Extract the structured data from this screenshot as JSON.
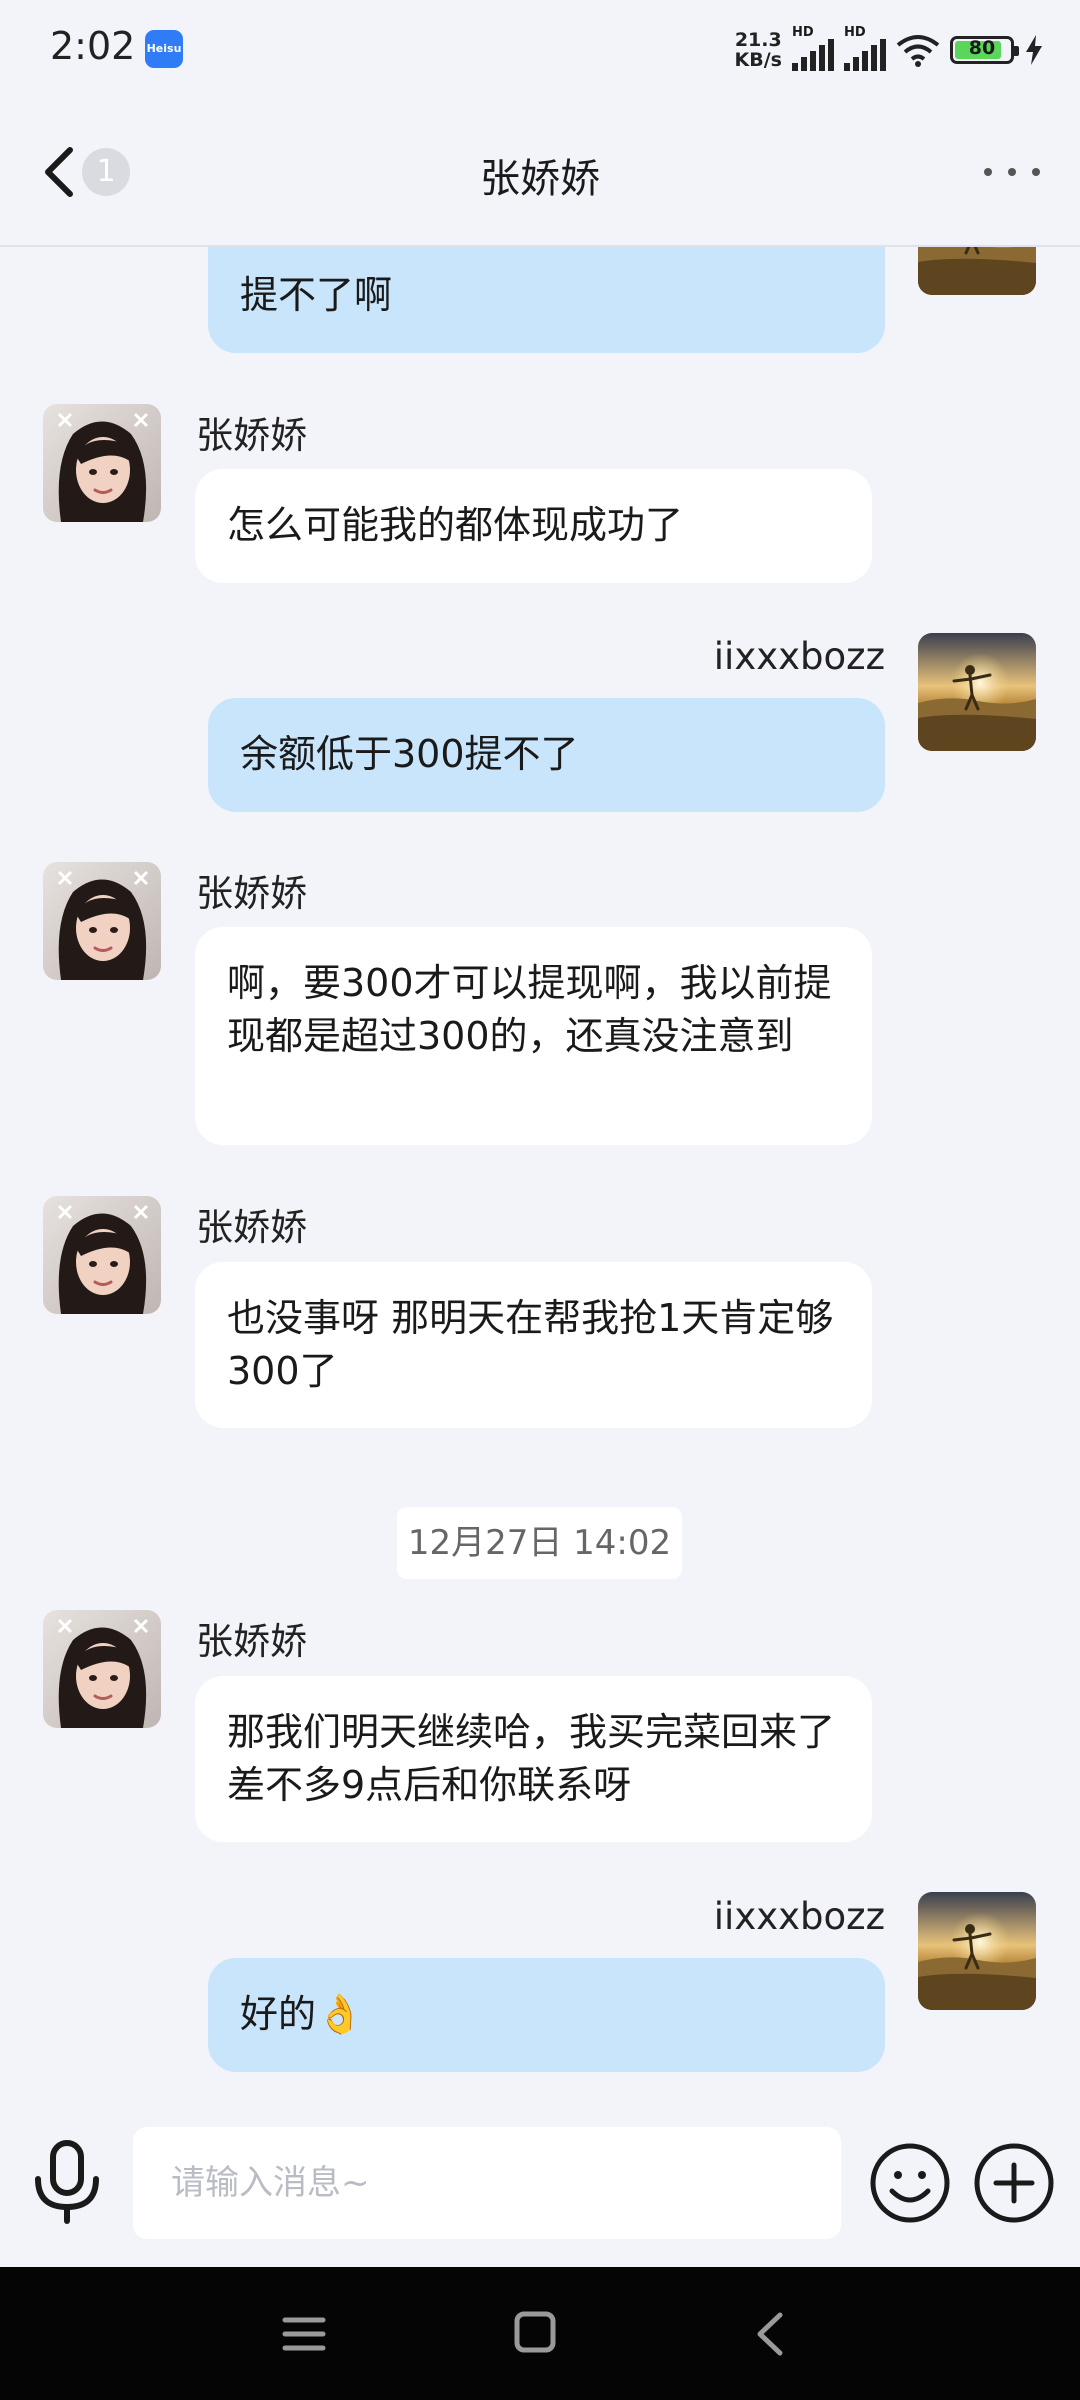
{
  "status_bar": {
    "time": "2:02",
    "app_icon_text": "Heisu",
    "net_speed_value": "21.3",
    "net_speed_unit": "KB/s",
    "signal_label": "HD",
    "battery": "80"
  },
  "header": {
    "title": "张娇娇",
    "unread_count": "1"
  },
  "messages": [
    {
      "text": "提不了啊"
    },
    {
      "sender": "张娇娇",
      "text": "怎么可能我的都体现成功了"
    },
    {
      "sender": "iixxxbozz",
      "text": "余额低于300提不了"
    },
    {
      "sender": "张娇娇",
      "text": "啊，要300才可以提现啊，我以前提现都是超过300的，还真没注意到"
    },
    {
      "sender": "张娇娇",
      "text": "也没事呀 那明天在帮我抢1天肯定够300了"
    },
    {
      "time": "12月27日 14:02"
    },
    {
      "sender": "张娇娇",
      "text": "那我们明天继续哈，我买完菜回来了 差不多9点后和你联系呀"
    },
    {
      "sender": "iixxxbozz",
      "text": "好的",
      "emoji": "👌"
    }
  ],
  "input": {
    "placeholder": "请输入消息~"
  },
  "colors": {
    "background": "#f2f4f9",
    "incoming_bubble": "#ffffff",
    "outgoing_bubble": "#c8e5fb",
    "nav_bar": "#050505"
  },
  "icons": [
    "back-chevron-icon",
    "more-icon",
    "microphone-icon",
    "emoji-icon",
    "plus-icon",
    "menu-icon",
    "home-icon",
    "nav-back-icon",
    "wifi-icon",
    "battery-icon",
    "charging-icon"
  ]
}
